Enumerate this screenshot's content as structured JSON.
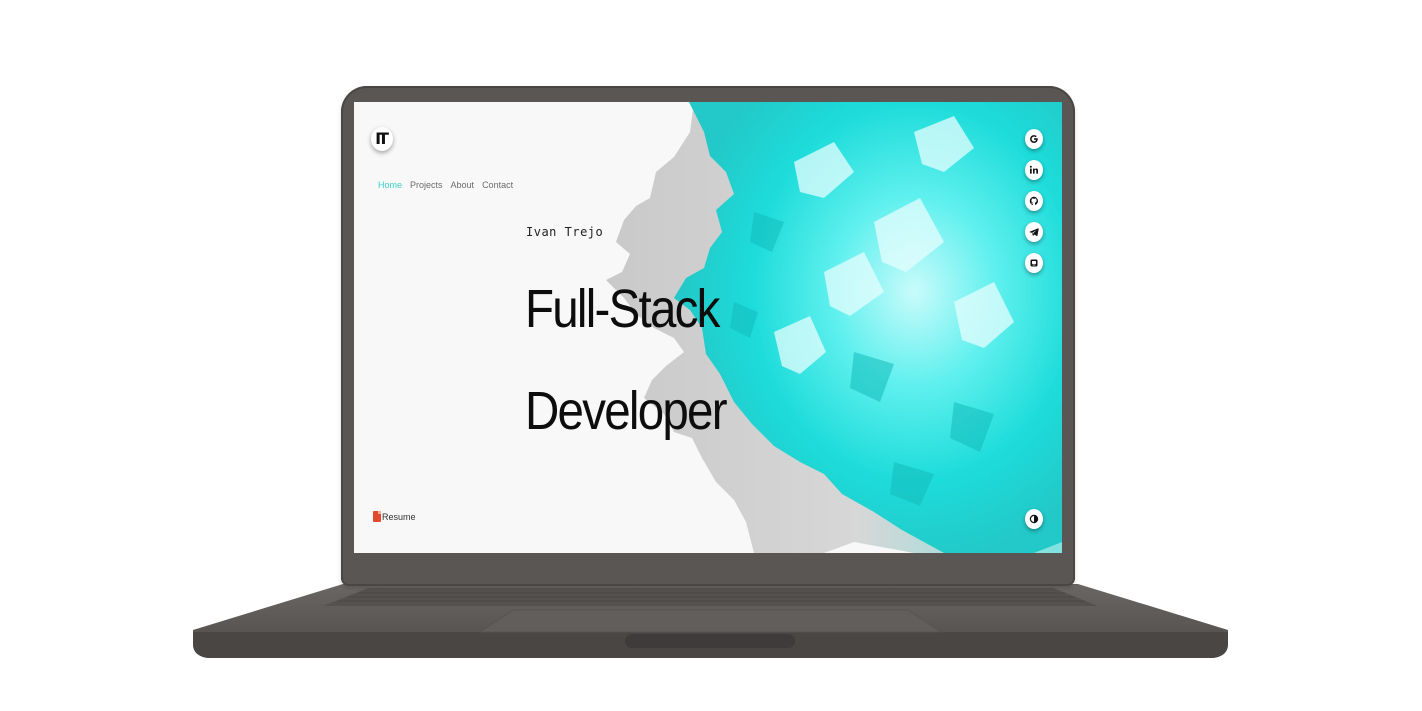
{
  "logo": {
    "text": "IT",
    "icon": "monogram-logo"
  },
  "nav": {
    "items": [
      {
        "label": "Home",
        "active": true
      },
      {
        "label": "Projects",
        "active": false
      },
      {
        "label": "About",
        "active": false
      },
      {
        "label": "Contact",
        "active": false
      }
    ]
  },
  "hero": {
    "name": "Ivan Trejo",
    "line1": "Full-Stack",
    "line2": "Developer"
  },
  "socials": [
    "google-icon",
    "linkedin-icon",
    "github-icon",
    "telegram-icon",
    "discord-icon"
  ],
  "resume": {
    "label": "Resume",
    "icon": "document-icon"
  },
  "theme_toggle": {
    "icon": "half-moon-icon"
  },
  "colors": {
    "accent": "#3fcfc7",
    "art_cyan": "#19e6e2",
    "bezel": "#5a5654",
    "text": "#0d0d0d"
  }
}
